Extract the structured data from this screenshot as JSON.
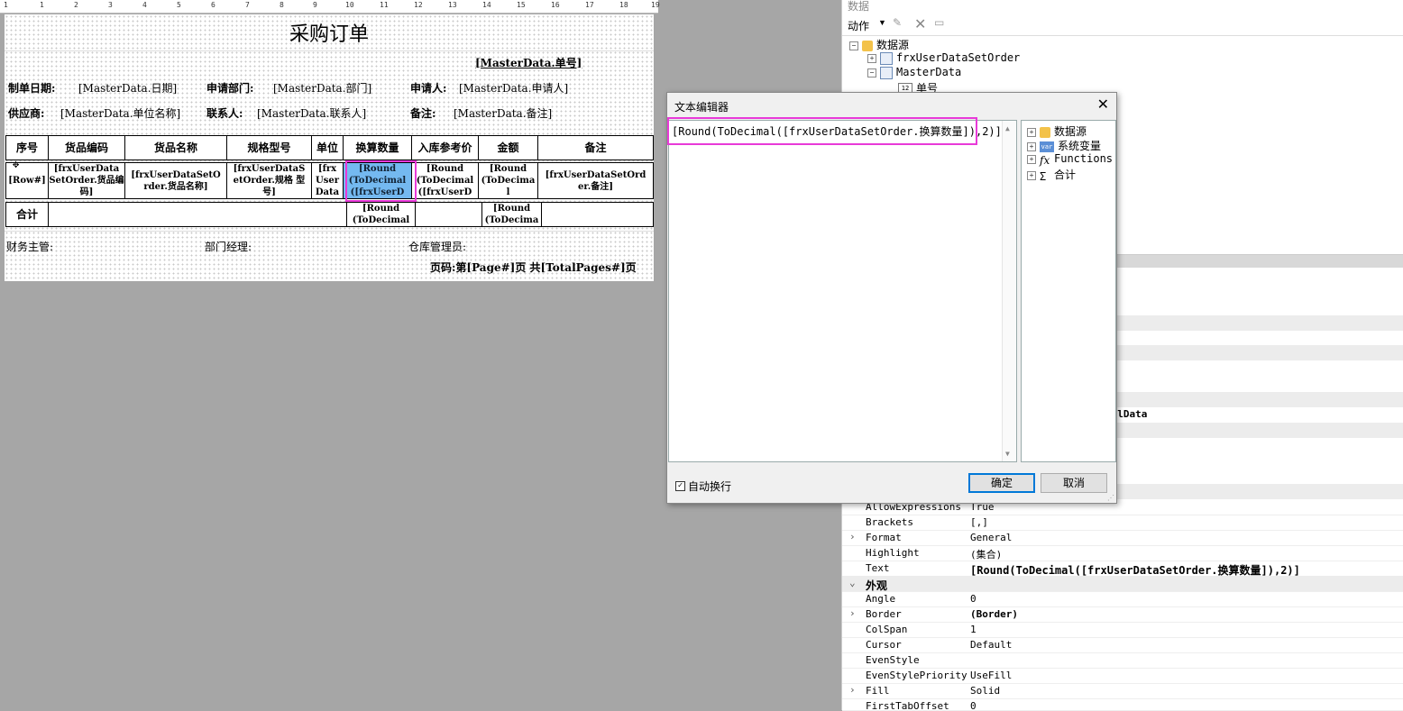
{
  "ruler": {
    "marks": [
      "1",
      "1",
      "2",
      "3",
      "4",
      "5",
      "6",
      "7",
      "8",
      "9",
      "10",
      "11",
      "12",
      "13",
      "14",
      "15",
      "16",
      "17",
      "18",
      "19"
    ]
  },
  "report": {
    "title": "采购订单",
    "order_no": "[MasterData.单号]",
    "row1": {
      "l1": "制单日期:",
      "v1": "[MasterData.日期]",
      "l2": "申请部门:",
      "v2": "[MasterData.部门]",
      "l3": "申请人:",
      "v3": "[MasterData.申请人]"
    },
    "row2": {
      "l1": "供应商:",
      "v1": "[MasterData.单位名称]",
      "l2": "联系人:",
      "v2": "[MasterData.联系人]",
      "l3": "备注:",
      "v3": "[MasterData.备注]"
    },
    "headers": [
      "序号",
      "货品编码",
      "货品名称",
      "规格型号",
      "单位",
      "换算数量",
      "入库参考价",
      "金额",
      "备注"
    ],
    "data_row": [
      "[Row#]",
      "[frxUserData SetOrder.货品编码]",
      "[frxUserDataSetO rder.货品名称]",
      "[frxUserDataS etOrder.规格 型号]",
      "[frx User Data",
      "[Round (ToDecimal ([frxUserD",
      "[Round (ToDecimal ([frxUserD",
      "[Round (ToDecima l",
      "[frxUserDataSetOrd er.备注]"
    ],
    "total_label": "合计",
    "total_qty": "[Round (ToDecimal",
    "total_amt": "[Round (ToDecima",
    "footer": {
      "f1": "财务主管:",
      "f2": "部门经理:",
      "f3": "仓库管理员:"
    },
    "page_text": "页码:第[Page#]页 共[TotalPages#]页"
  },
  "panel": {
    "title": "数据",
    "action_label": "动作",
    "tree": [
      {
        "label": "数据源"
      },
      {
        "label": "frxUserDataSetOrder"
      },
      {
        "label": "MasterData"
      },
      {
        "label": "单号"
      }
    ],
    "partial_value": "ellData",
    "props": [
      {
        "name": "AllowExpressions",
        "value": "True"
      },
      {
        "name": "Brackets",
        "value": "[,]"
      },
      {
        "name": "Format",
        "value": "General"
      },
      {
        "name": "Highlight",
        "value": "(集合)"
      },
      {
        "name": "Text",
        "value": "[Round(ToDecimal([frxUserDataSetOrder.换算数量]),2)]"
      },
      {
        "name": "外观",
        "value": ""
      },
      {
        "name": "Angle",
        "value": "0"
      },
      {
        "name": "Border",
        "value": "(Border)"
      },
      {
        "name": "ColSpan",
        "value": "1"
      },
      {
        "name": "Cursor",
        "value": "Default"
      },
      {
        "name": "EvenStyle",
        "value": ""
      },
      {
        "name": "EvenStylePriority",
        "value": "UseFill"
      },
      {
        "name": "Fill",
        "value": "Solid"
      },
      {
        "name": "FirstTabOffset",
        "value": "0"
      }
    ]
  },
  "dialog": {
    "title": "文本编辑器",
    "text": "[Round(ToDecimal([frxUserDataSetOrder.换算数量]),2)]",
    "tree": [
      "数据源",
      "系统变量",
      "Functions",
      "合计"
    ],
    "var_badge": "var",
    "fx_glyph": "fx",
    "sum_glyph": "Σ",
    "wrap_label": "自动换行",
    "ok": "确定",
    "cancel": "取消"
  },
  "colors": {
    "highlight": "#e83ad8",
    "selected_cell": "#74b9f0"
  }
}
